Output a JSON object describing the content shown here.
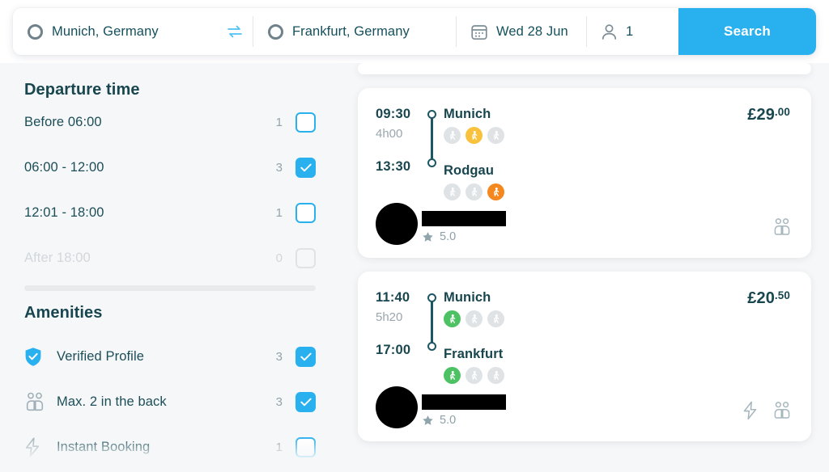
{
  "search": {
    "origin": "Munich, Germany",
    "origin_icon": "location-circle-icon",
    "destination": "Frankfurt, Germany",
    "destination_icon": "location-circle-icon",
    "swap_icon": "swap-arrows-icon",
    "date": "Wed 28 Jun",
    "date_icon": "calendar-icon",
    "passengers": "1",
    "passengers_icon": "person-icon",
    "search_label": "Search",
    "accent_color": "#29b0ef"
  },
  "sidebar": {
    "departure": {
      "title": "Departure time",
      "options": [
        {
          "label": "Before 06:00",
          "count": "1",
          "checked": false,
          "disabled": false
        },
        {
          "label": "06:00 - 12:00",
          "count": "3",
          "checked": true,
          "disabled": false
        },
        {
          "label": "12:01 - 18:00",
          "count": "1",
          "checked": false,
          "disabled": false
        },
        {
          "label": "After 18:00",
          "count": "0",
          "checked": false,
          "disabled": true
        }
      ]
    },
    "amenities": {
      "title": "Amenities",
      "options": [
        {
          "label": "Verified Profile",
          "count": "3",
          "checked": true,
          "icon": "shield-check-icon"
        },
        {
          "label": "Max. 2 in the back",
          "count": "3",
          "checked": true,
          "icon": "two-people-icon"
        },
        {
          "label": "Instant Booking",
          "count": "1",
          "checked": false,
          "icon": "lightning-bolt-icon"
        }
      ]
    }
  },
  "results": {
    "rides": [
      {
        "depart_time": "09:30",
        "duration": "4h00",
        "arrive_time": "13:30",
        "origin": "Munich",
        "destination": "Rodgau",
        "price_main": "£29",
        "price_cents": ".00",
        "rating": "5.0",
        "rating_icon": "star-icon",
        "origin_seats": [
          "free",
          "yellow",
          "free"
        ],
        "destination_seats": [
          "free",
          "free",
          "orange"
        ],
        "badges": [
          "two-people-icon"
        ]
      },
      {
        "depart_time": "11:40",
        "duration": "5h20",
        "arrive_time": "17:00",
        "origin": "Munich",
        "destination": "Frankfurt",
        "price_main": "£20",
        "price_cents": ".50",
        "rating": "5.0",
        "rating_icon": "star-icon",
        "origin_seats": [
          "green",
          "free",
          "free"
        ],
        "destination_seats": [
          "green",
          "free",
          "free"
        ],
        "badges": [
          "lightning-bolt-icon",
          "two-people-icon"
        ]
      }
    ]
  },
  "colors": {
    "accent": "#29b0ef",
    "text_dark": "#18464f",
    "seat_free": "#dfe3e6",
    "seat_green": "#4cc264",
    "seat_yellow": "#f9c23c",
    "seat_orange": "#f4871e",
    "page_bg": "#f6f7f9"
  }
}
